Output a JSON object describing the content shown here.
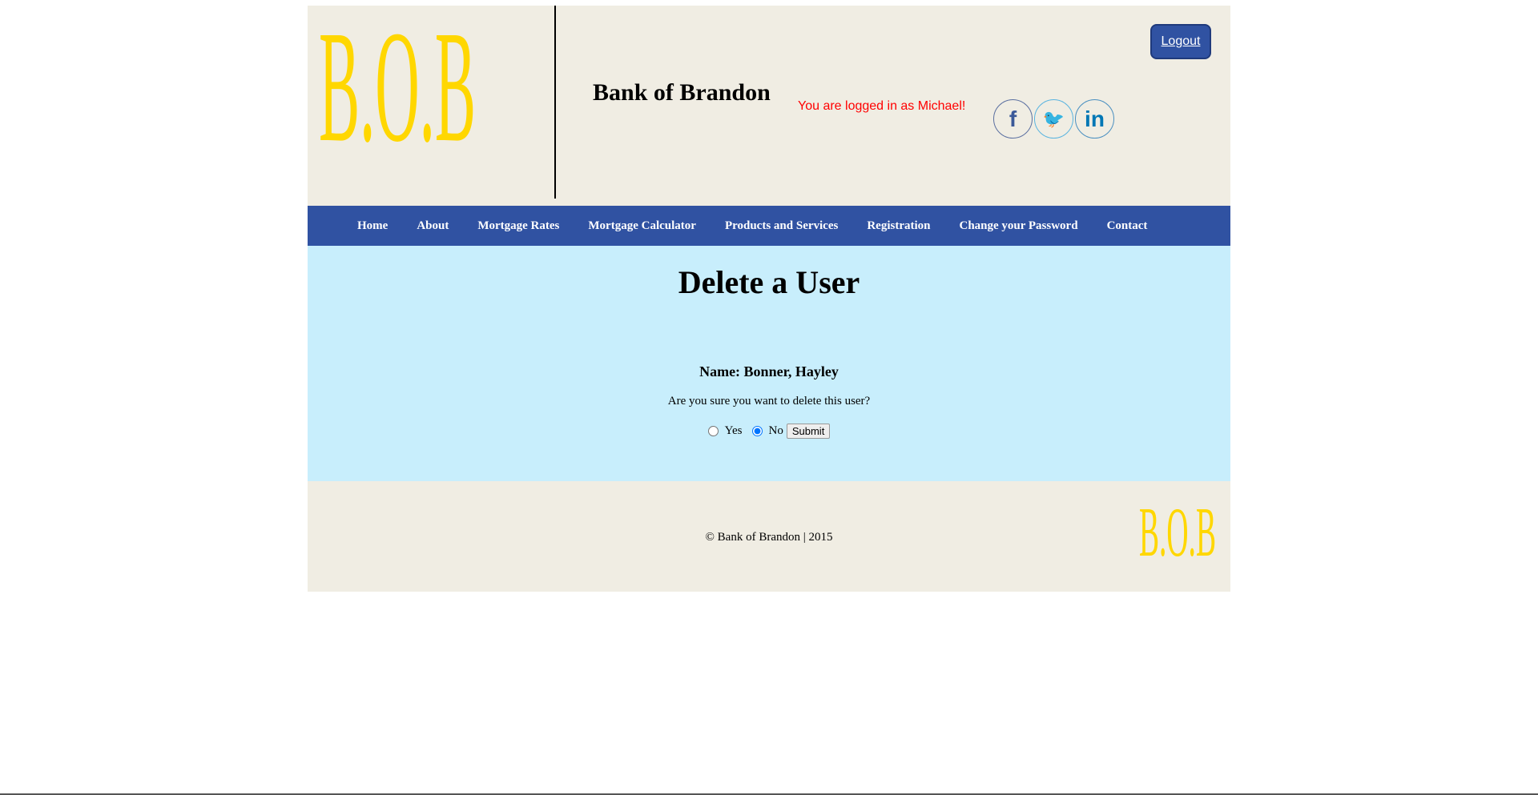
{
  "header": {
    "logo_text": "B.O.B",
    "brand": "Bank of Brandon",
    "logged_in": "You are logged in as Michael!",
    "logout_label": "Logout",
    "social": [
      {
        "icon": "facebook-icon",
        "glyph": "f",
        "color": "#3b5998"
      },
      {
        "icon": "twitter-icon",
        "glyph": "🐦",
        "color": "#1da1f2"
      },
      {
        "icon": "linkedin-icon",
        "glyph": "in",
        "color": "#0077b5"
      }
    ]
  },
  "nav": {
    "items": [
      "Home",
      "About",
      "Mortgage Rates",
      "Mortgage Calculator",
      "Products and Services",
      "Registration",
      "Change your Password",
      "Contact"
    ]
  },
  "main": {
    "title": "Delete a User",
    "name": "Name: Bonner, Hayley",
    "question": "Are you sure you want to delete this user?",
    "options": [
      {
        "label": "Yes",
        "checked": false
      },
      {
        "label": "No",
        "checked": true
      }
    ],
    "submit_label": "Submit"
  },
  "footer": {
    "copyright": "© Bank of Brandon | 2015",
    "logo_text": "B.O.B"
  },
  "colors": {
    "logo": "#ffd700",
    "nav": "#3052a2",
    "content_bg": "#c8eefc",
    "header_bg": "#f0ede3",
    "logged_in": "#ff0000"
  }
}
